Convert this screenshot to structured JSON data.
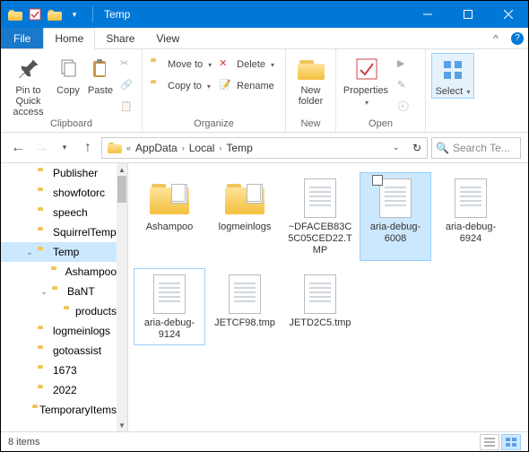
{
  "window": {
    "title": "Temp"
  },
  "menubar": {
    "file": "File",
    "home": "Home",
    "share": "Share",
    "view": "View"
  },
  "ribbon": {
    "pin": "Pin to Quick access",
    "copy": "Copy",
    "paste": "Paste",
    "clipboard": "Clipboard",
    "moveto": "Move to",
    "copyto": "Copy to",
    "delete": "Delete",
    "rename": "Rename",
    "organize": "Organize",
    "newfolder": "New folder",
    "new": "New",
    "properties": "Properties",
    "open": "Open",
    "select": "Select"
  },
  "breadcrumb": {
    "seg1": "AppData",
    "seg2": "Local",
    "seg3": "Temp"
  },
  "search": {
    "placeholder": "Search Te..."
  },
  "tree": {
    "items": [
      {
        "label": "Publisher",
        "indent": 26,
        "exp": ""
      },
      {
        "label": "showfotorc",
        "indent": 26,
        "exp": ""
      },
      {
        "label": "speech",
        "indent": 26,
        "exp": ""
      },
      {
        "label": "SquirrelTemp",
        "indent": 26,
        "exp": ""
      },
      {
        "label": "Temp",
        "indent": 26,
        "exp": "v",
        "sel": true
      },
      {
        "label": "Ashampoo",
        "indent": 42,
        "exp": ""
      },
      {
        "label": "BaNT",
        "indent": 42,
        "exp": "v"
      },
      {
        "label": "products",
        "indent": 58,
        "exp": ""
      },
      {
        "label": "logmeinlogs",
        "indent": 26,
        "exp": ""
      },
      {
        "label": "gotoassist",
        "indent": 26,
        "exp": ""
      },
      {
        "label": "1673",
        "indent": 26,
        "exp": ""
      },
      {
        "label": "2022",
        "indent": 26,
        "exp": ""
      },
      {
        "label": "TemporaryItems",
        "indent": 26,
        "exp": ""
      }
    ]
  },
  "files": {
    "items": [
      {
        "name": "Ashampoo",
        "type": "folder"
      },
      {
        "name": "logmeinlogs",
        "type": "folder"
      },
      {
        "name": "~DFACEB83C5C05CED22.TMP",
        "type": "file"
      },
      {
        "name": "aria-debug-6008",
        "type": "file",
        "sel": true,
        "cb": true
      },
      {
        "name": "aria-debug-6924",
        "type": "file"
      },
      {
        "name": "aria-debug-9124",
        "type": "file",
        "foc": true
      },
      {
        "name": "JETCF98.tmp",
        "type": "file"
      },
      {
        "name": "JETD2C5.tmp",
        "type": "file"
      }
    ]
  },
  "status": {
    "count": "8 items"
  }
}
